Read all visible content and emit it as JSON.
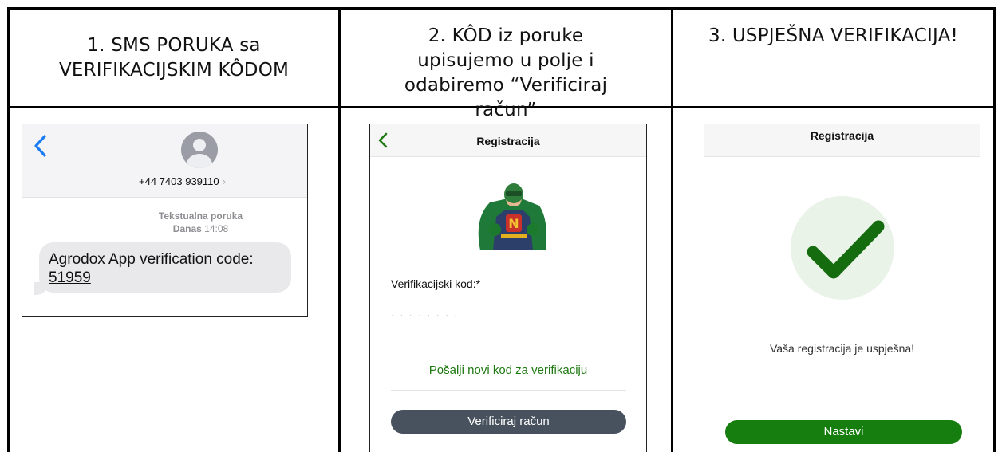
{
  "columns": {
    "col1_title": "1. SMS PORUKA sa VERIFIKACIJSKIM KÔDOM",
    "col2_title": "2. KÔD iz poruke upisujemo u polje i odabiremo “Verificiraj račun”",
    "col3_title": "3. USPJEŠNA VERIFIKACIJA!"
  },
  "sms": {
    "phone_number": "+44 7403 939110",
    "chevron": "›",
    "message_type": "Tekstualna poruka",
    "day": "Danas",
    "time": "14:08",
    "message_text": "Agrodox App verification code:",
    "code": "51959",
    "icons": [
      "back-chevron-icon",
      "contact-avatar-icon"
    ]
  },
  "registration": {
    "title": "Registracija",
    "code_label": "Verifikacijski kod:*",
    "code_placeholder": "· · · · · · · ·",
    "resend_link": "Pošalji novi kod za verifikaciju",
    "verify_button": "Verificiraj račun",
    "accent_color": "#1f7a12",
    "button_color": "#48525e"
  },
  "success": {
    "title": "Registracija",
    "message": "Vaša registracija je uspješna!",
    "continue_button": "Nastavi",
    "button_color": "#167d0f",
    "check_color": "#146c0f"
  }
}
